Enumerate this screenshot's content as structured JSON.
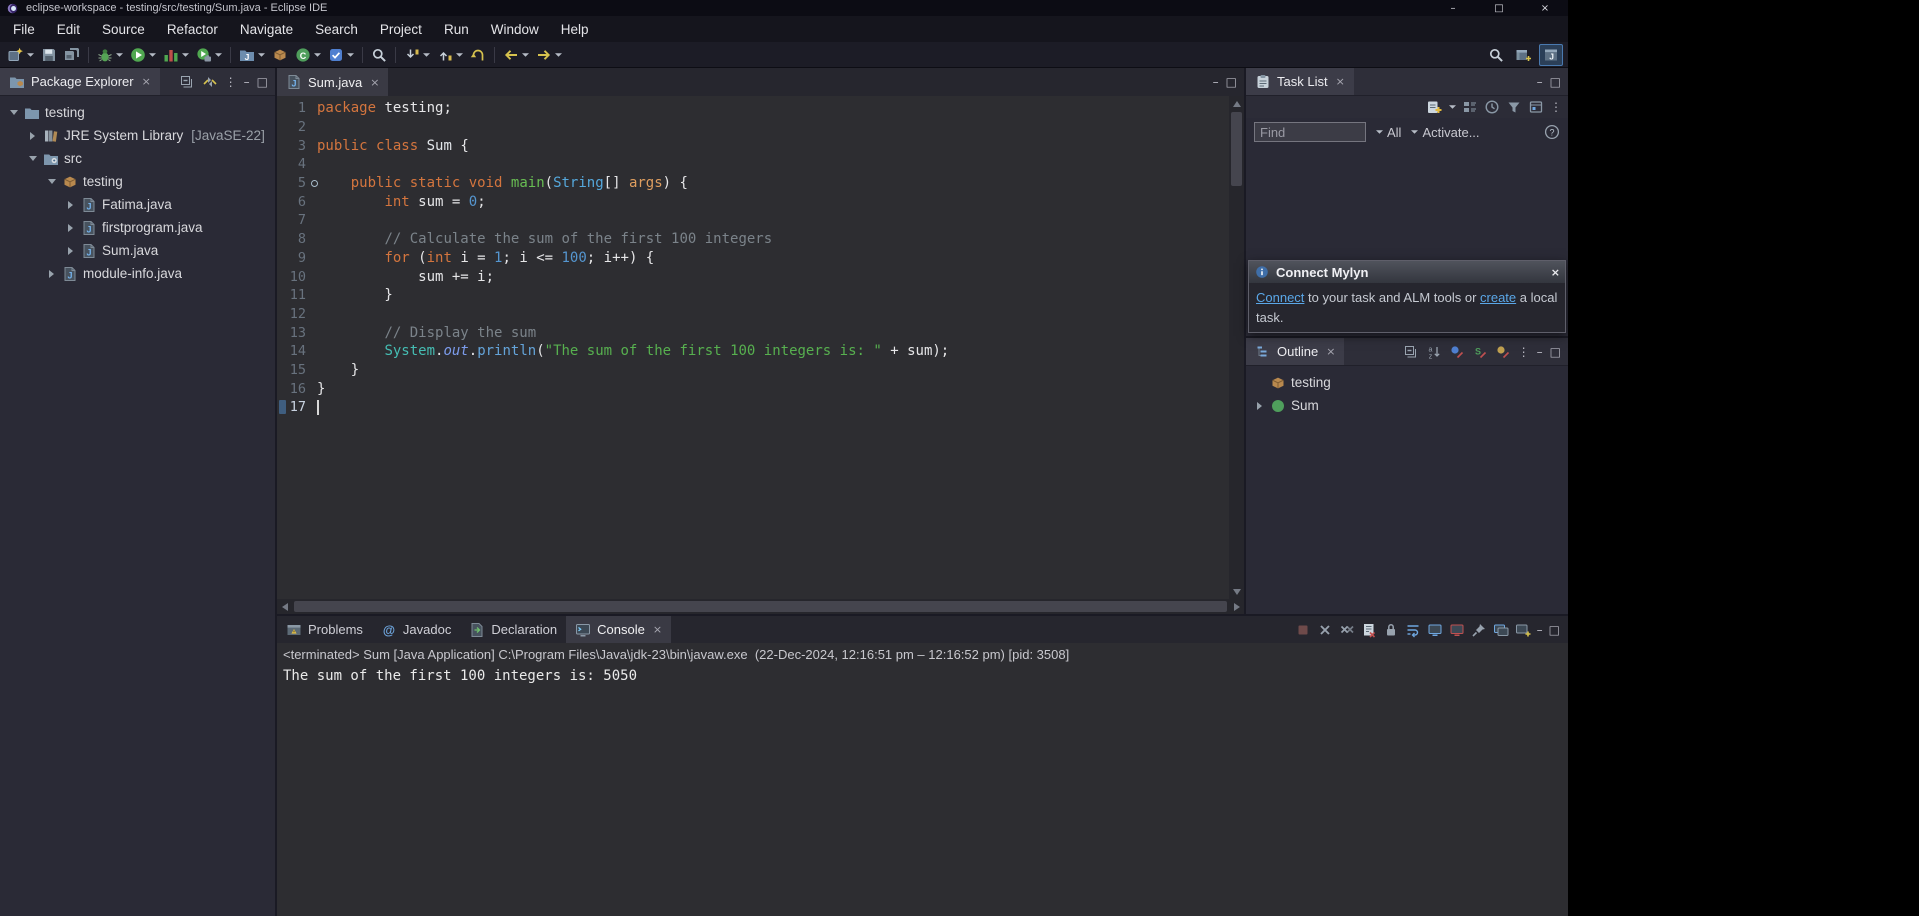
{
  "window": {
    "title": "eclipse-workspace - testing/src/testing/Sum.java - Eclipse IDE"
  },
  "window_controls": {
    "minimize": "–",
    "maximize": "□",
    "close": "×"
  },
  "glyphs": {
    "close": "×",
    "minimize": "–",
    "maximize": "□",
    "view_menu": "⋮"
  },
  "menubar": [
    "File",
    "Edit",
    "Source",
    "Refactor",
    "Navigate",
    "Search",
    "Project",
    "Run",
    "Window",
    "Help"
  ],
  "toolbar": {
    "main": [
      {
        "name": "new",
        "drop": true
      },
      {
        "name": "save",
        "drop": false
      },
      {
        "name": "save-all",
        "drop": false
      },
      {
        "name": "debug",
        "drop": true
      },
      {
        "name": "run",
        "drop": true
      },
      {
        "name": "coverage",
        "drop": true
      },
      {
        "name": "external-tools",
        "drop": true
      },
      {
        "name": "new-java-project",
        "drop": true
      },
      {
        "name": "new-package",
        "drop": false
      },
      {
        "name": "new-class",
        "drop": true
      },
      {
        "name": "open-task",
        "drop": true
      },
      {
        "name": "search",
        "drop": false
      },
      {
        "name": "next-annotation",
        "drop": true
      },
      {
        "name": "previous-annotation",
        "drop": true
      },
      {
        "name": "last-edit-location",
        "drop": false
      },
      {
        "name": "back",
        "drop": true
      },
      {
        "name": "forward",
        "drop": true
      }
    ],
    "right": [
      {
        "name": "quick-search",
        "active": false
      },
      {
        "name": "open-perspective",
        "active": false
      },
      {
        "name": "java-perspective",
        "active": true
      }
    ]
  },
  "package_explorer": {
    "tab": "Package Explorer",
    "toolbar_icons": [
      "collapse-all",
      "link-with-editor",
      "view-menu",
      "minimize",
      "maximize"
    ],
    "tree": [
      {
        "label": "testing",
        "lvl": 0,
        "icon": "project",
        "chev": "down"
      },
      {
        "label": "JRE System Library",
        "sub": "[JavaSE-22]",
        "lvl": 1,
        "icon": "library",
        "chev": "right"
      },
      {
        "label": "src",
        "lvl": 1,
        "icon": "src-folder",
        "chev": "down"
      },
      {
        "label": "testing",
        "lvl": 2,
        "icon": "package",
        "chev": "down"
      },
      {
        "label": "Fatima.java",
        "lvl": 3,
        "icon": "java-file",
        "chev": "right"
      },
      {
        "label": "firstprogram.java",
        "lvl": 3,
        "icon": "java-file",
        "chev": "right"
      },
      {
        "label": "Sum.java",
        "lvl": 3,
        "icon": "java-file",
        "chev": "right"
      },
      {
        "label": "module-info.java",
        "lvl": 2,
        "icon": "java-file",
        "chev": "right"
      }
    ]
  },
  "editor": {
    "tab": "Sum.java",
    "lines": [
      {
        "n": 1,
        "toks": [
          [
            "k",
            "package"
          ],
          [
            "p",
            " testing;"
          ]
        ]
      },
      {
        "n": 2,
        "toks": []
      },
      {
        "n": 3,
        "toks": [
          [
            "k",
            "public"
          ],
          [
            "p",
            " "
          ],
          [
            "k",
            "class"
          ],
          [
            "p",
            " "
          ],
          [
            "cl",
            "Sum"
          ],
          [
            "p",
            " {"
          ]
        ]
      },
      {
        "n": 4,
        "toks": []
      },
      {
        "n": 5,
        "marker": "launch",
        "toks": [
          [
            "p",
            "    "
          ],
          [
            "k",
            "public"
          ],
          [
            "p",
            " "
          ],
          [
            "k",
            "static"
          ],
          [
            "p",
            " "
          ],
          [
            "k",
            "void"
          ],
          [
            "p",
            " "
          ],
          [
            "m",
            "main"
          ],
          [
            "p",
            "("
          ],
          [
            "ty",
            "String"
          ],
          [
            "p",
            "[] "
          ],
          [
            "pr",
            "args"
          ],
          [
            "p",
            ") {"
          ]
        ]
      },
      {
        "n": 6,
        "toks": [
          [
            "p",
            "        "
          ],
          [
            "k",
            "int"
          ],
          [
            "p",
            " sum = "
          ],
          [
            "n2",
            "0"
          ],
          [
            "p",
            ";"
          ]
        ]
      },
      {
        "n": 7,
        "toks": []
      },
      {
        "n": 8,
        "toks": [
          [
            "p",
            "        "
          ],
          [
            "c",
            "// Calculate the sum of the first 100 integers"
          ]
        ]
      },
      {
        "n": 9,
        "toks": [
          [
            "p",
            "        "
          ],
          [
            "k",
            "for"
          ],
          [
            "p",
            " ("
          ],
          [
            "k",
            "int"
          ],
          [
            "p",
            " i = "
          ],
          [
            "n2",
            "1"
          ],
          [
            "p",
            "; i <= "
          ],
          [
            "n2",
            "100"
          ],
          [
            "p",
            "; i++) {"
          ]
        ]
      },
      {
        "n": 10,
        "toks": [
          [
            "p",
            "            sum += i;"
          ]
        ]
      },
      {
        "n": 11,
        "toks": [
          [
            "p",
            "        }"
          ]
        ]
      },
      {
        "n": 12,
        "toks": []
      },
      {
        "n": 13,
        "toks": [
          [
            "p",
            "        "
          ],
          [
            "c",
            "// Display the sum"
          ]
        ]
      },
      {
        "n": 14,
        "toks": [
          [
            "p",
            "        "
          ],
          [
            "sys",
            "System"
          ],
          [
            "p",
            "."
          ],
          [
            "fl",
            "out"
          ],
          [
            "p",
            "."
          ],
          [
            "mc",
            "println"
          ],
          [
            "p",
            "("
          ],
          [
            "s",
            "\"The sum of the first 100 integers is: \""
          ],
          [
            "p",
            " + sum);"
          ]
        ]
      },
      {
        "n": 15,
        "toks": [
          [
            "p",
            "    }"
          ]
        ]
      },
      {
        "n": 16,
        "toks": [
          [
            "p",
            "}"
          ]
        ]
      },
      {
        "n": 17,
        "current": true,
        "toks": []
      }
    ]
  },
  "task_list": {
    "tab": "Task List",
    "toolbar_icons": [
      "new-task",
      "categorized",
      "scheduled",
      "filter-completed",
      "focus-workweek",
      "view-menu"
    ],
    "find_placeholder": "Find",
    "filters": [
      "All",
      "Activate..."
    ]
  },
  "mylyn_popup": {
    "title": "Connect Mylyn",
    "segments": [
      {
        "type": "link",
        "text": "Connect"
      },
      {
        "type": "text",
        "text": " to your task and ALM tools or "
      },
      {
        "type": "link",
        "text": "create"
      },
      {
        "type": "text",
        "text": " a local task."
      }
    ]
  },
  "outline": {
    "tab": "Outline",
    "toolbar_icons": [
      "collapse-all",
      "sort",
      "hide-fields",
      "hide-static",
      "hide-non-public",
      "view-menu",
      "minimize",
      "maximize"
    ],
    "items": [
      {
        "label": "testing",
        "icon": "package",
        "chev": null
      },
      {
        "label": "Sum",
        "icon": "class",
        "chev": "right"
      }
    ]
  },
  "console": {
    "tabs": [
      {
        "label": "Problems",
        "icon": "problems",
        "active": false
      },
      {
        "label": "Javadoc",
        "icon": "javadoc",
        "active": false
      },
      {
        "label": "Declaration",
        "icon": "declaration",
        "active": false
      },
      {
        "label": "Console",
        "icon": "console",
        "active": true
      }
    ],
    "toolbar_icons": [
      "terminate",
      "remove-launch",
      "remove-all-launches",
      "clear-console",
      "scroll-lock",
      "word-wrap",
      "show-stdout",
      "show-stderr",
      "pin-console",
      "display-selected-console",
      "open-console",
      "minimize",
      "maximize"
    ],
    "status": "<terminated> Sum [Java Application] C:\\Program Files\\Java\\jdk-23\\bin\\javaw.exe  (22-Dec-2024, 12:16:51 pm – 12:16:52 pm) [pid: 3508]",
    "output": "The sum of the first 100 integers is: 5050"
  },
  "colors": {
    "keyword": "#d4753e",
    "plain": "#e6e6e8",
    "comment": "#7b838a",
    "number": "#5596d0",
    "string": "#57b04f",
    "method_decl": "#68bd53",
    "class_decl": "#e2e6ea",
    "type_ref": "#55a8dc",
    "system_type": "#45bdb3",
    "field": "#7c9ced",
    "method_call": "#64a4da",
    "parameter": "#df9e5f",
    "link": "#5aa7e8",
    "accent_selection": "#3f5e80"
  }
}
